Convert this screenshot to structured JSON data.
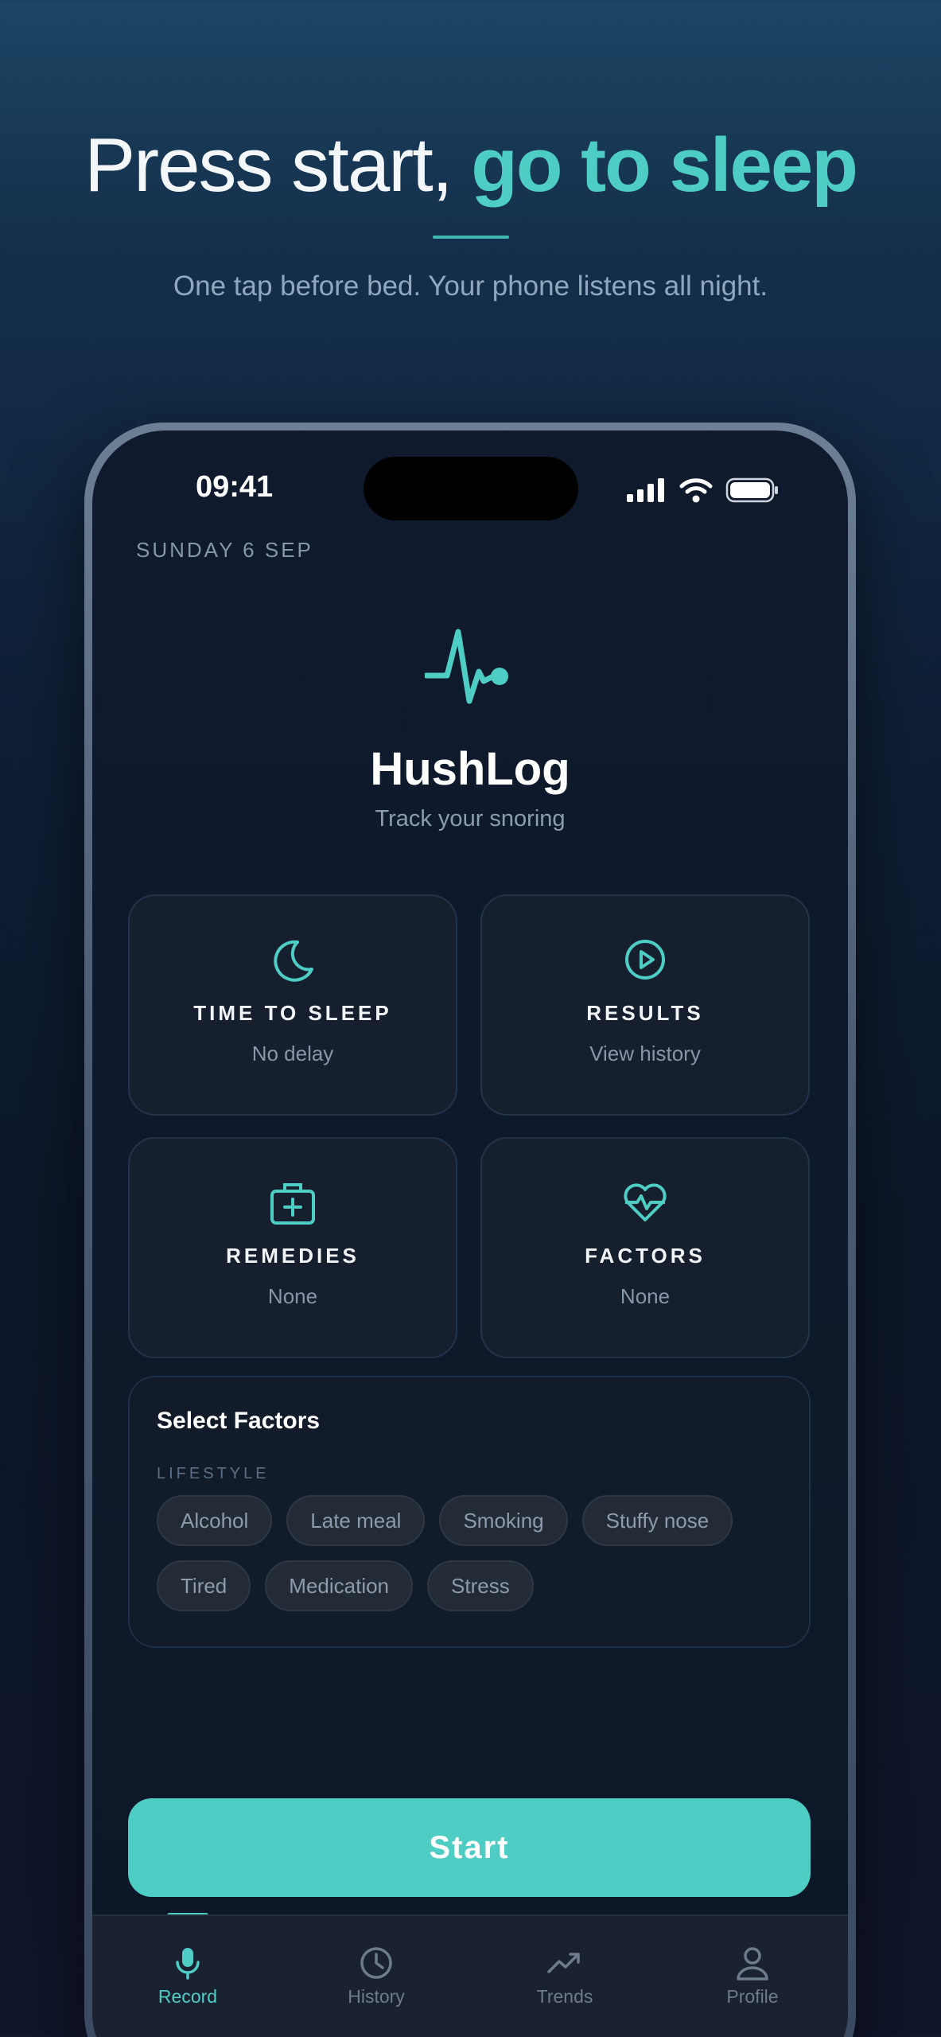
{
  "hero": {
    "title_part1": "Press start, ",
    "title_part2": "go to sleep",
    "subtitle": "One tap before bed. Your phone listens all night."
  },
  "status_bar": {
    "time": "09:41"
  },
  "date": "SUNDAY 6 SEP",
  "app": {
    "name": "HushLog",
    "tagline": "Track your snoring"
  },
  "cards": [
    {
      "title": "TIME TO SLEEP",
      "value": "No delay",
      "icon": "moon-icon"
    },
    {
      "title": "RESULTS",
      "value": "View history",
      "icon": "play-circle-icon"
    },
    {
      "title": "REMEDIES",
      "value": "None",
      "icon": "medical-kit-icon"
    },
    {
      "title": "FACTORS",
      "value": "None",
      "icon": "heart-pulse-icon"
    }
  ],
  "factors_panel": {
    "title": "Select Factors",
    "section_label": "LIFESTYLE",
    "chips": [
      "Alcohol",
      "Late meal",
      "Smoking",
      "Stuffy nose",
      "Tired",
      "Medication",
      "Stress"
    ]
  },
  "start_button": "Start",
  "tabs": [
    {
      "label": "Record",
      "icon": "microphone-icon",
      "active": true
    },
    {
      "label": "History",
      "icon": "clock-icon",
      "active": false
    },
    {
      "label": "Trends",
      "icon": "trend-up-icon",
      "active": false
    },
    {
      "label": "Profile",
      "icon": "person-icon",
      "active": false
    }
  ],
  "colors": {
    "accent": "#4ecdc4",
    "background_top": "#1c4564",
    "background_bottom": "#10152b",
    "card": "#161f2e"
  }
}
